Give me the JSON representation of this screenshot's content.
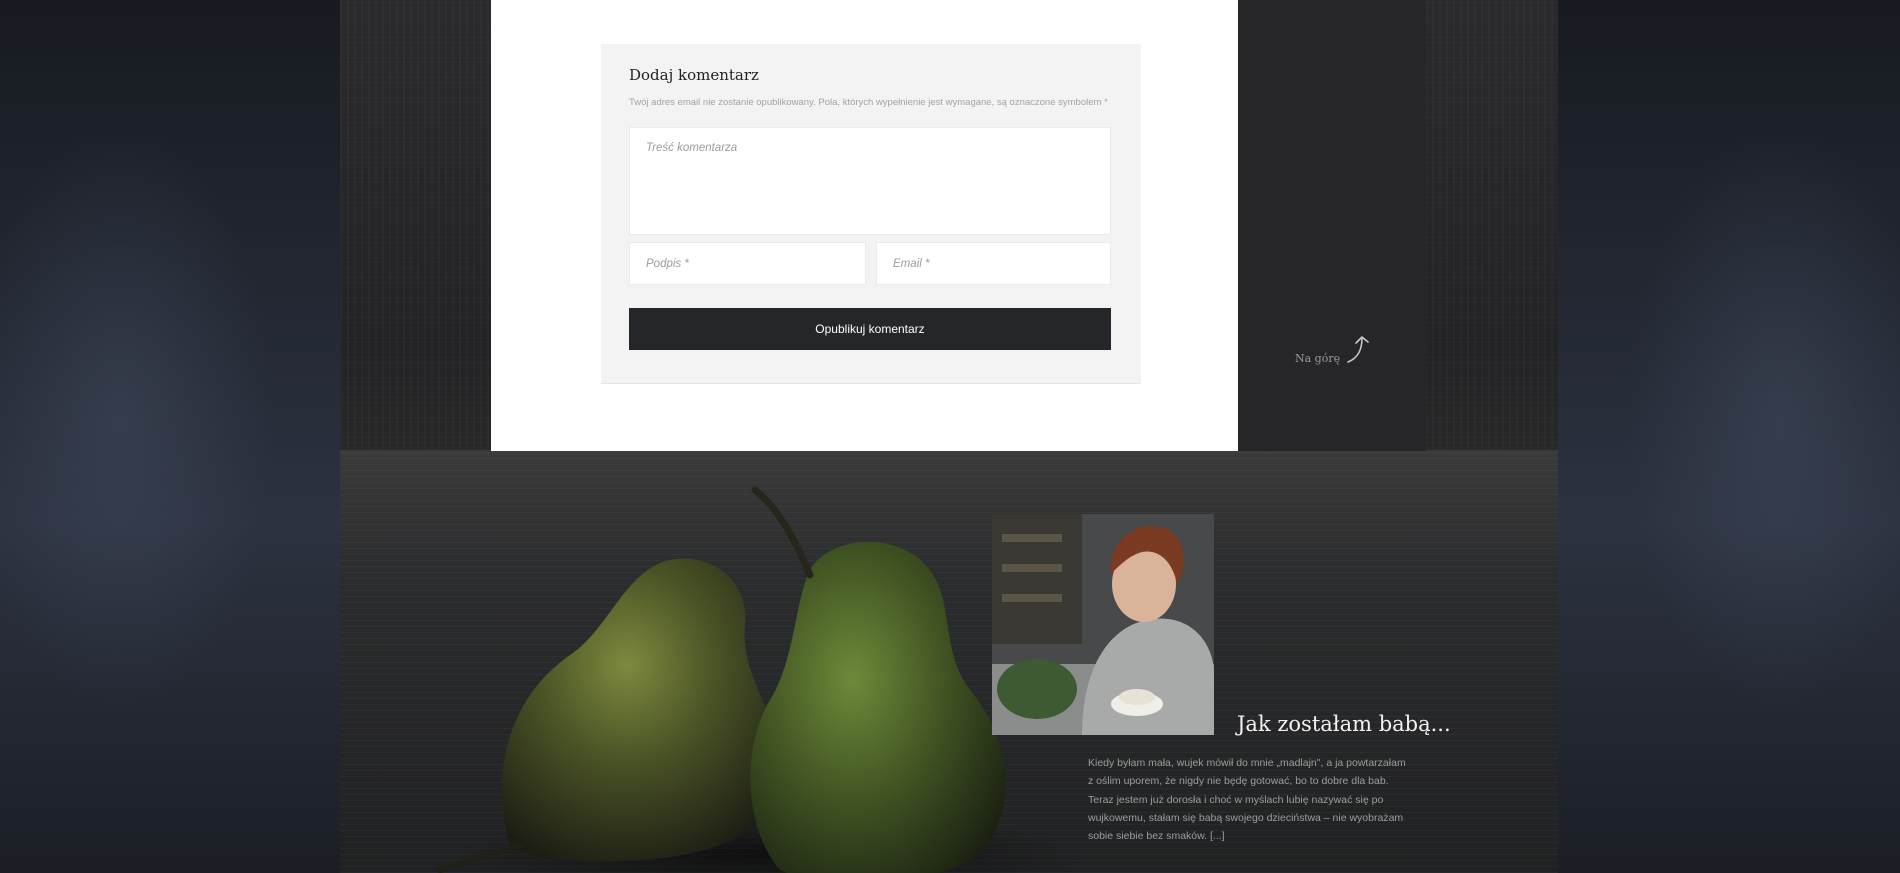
{
  "comment_form": {
    "title": "Dodaj komentarz",
    "note": "Twój adres email nie zostanie opublikowany. Pola, których wypełnienie jest wymagane, są oznaczone symbolem *",
    "comment_placeholder": "Treść komentarza",
    "name_placeholder": "Podpis *",
    "email_placeholder": "Email *",
    "submit_label": "Opublikuj komentarz"
  },
  "sidebar": {
    "back_to_top_label": "Na górę"
  },
  "featured_post": {
    "title": "Jak zostałam babą...",
    "excerpt": "Kiedy byłam mała, wujek mówił do mnie „madlajn\", a ja powtarzałam z oślim uporem, że nigdy nie będę gotować, bo to dobre dla bab. Teraz jestem już dorosła i choć w myślach lubię nazywać się po wujkowemu, stałam się babą swojego dzieciństwa – nie wyobrażam sobie siebie bez smaków. [...]"
  },
  "colors": {
    "page_background": "#1f232b",
    "content_background": "#ffffff",
    "form_background": "#f3f3f3",
    "button_background": "#252629",
    "sidebar_background": "#262628",
    "post_title": "#f2f2f2",
    "excerpt_text": "#9d9d9d"
  },
  "icons": {
    "back_to_top": "curved-arrow-up-icon"
  }
}
